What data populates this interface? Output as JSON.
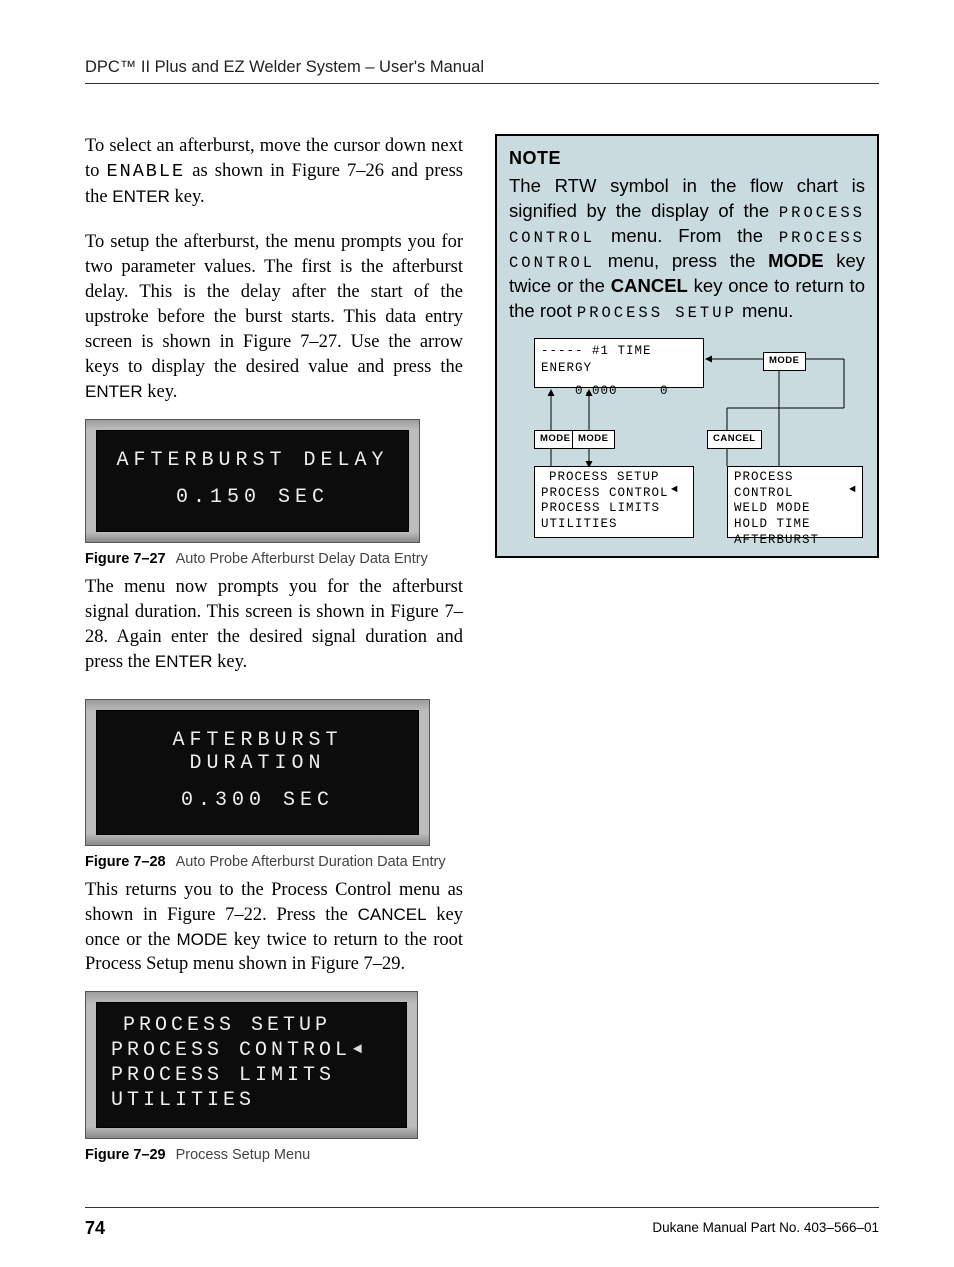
{
  "header": {
    "title": "DPC™ II Plus and EZ Welder System – User's Manual"
  },
  "body": {
    "p1_a": "To select an afterburst, move the cursor down next to ",
    "p1_b": " as shown in Figure 7–26 and press the ",
    "p1_c": " key.",
    "key_enable": "ENABLE",
    "key_enter": "ENTER",
    "p2_a": "To setup the afterburst, the menu prompts you for two parameter values. The first is the afterburst delay. This is the delay after the start of the upstroke before the burst starts. This data entry screen is shown in Figure 7–27. Use the arrow keys to display the desired value and press the ",
    "p2_b": " key.",
    "p3_a": "The menu now prompts you for the afterburst signal duration. This screen is shown in Figure 7–28. Again enter the desired signal duration and press the ",
    "p3_b": " key.",
    "p4_a": "This returns you to the Process Control menu as shown in Figure 7–22. Press the ",
    "p4_b": " key once or the ",
    "p4_c": " key twice to return to the root Process Setup menu shown in Figure 7–29.",
    "key_cancel": "CANCEL",
    "key_mode": "MODE"
  },
  "fig27": {
    "line1": "AFTERBURST DELAY",
    "line2": "0.150 SEC",
    "cap_num": "Figure 7–27",
    "cap_txt": "Auto Probe Afterburst Delay Data Entry"
  },
  "fig28": {
    "line1": "AFTERBURST DURATION",
    "line2": "0.300 SEC",
    "cap_num": "Figure 7–28",
    "cap_txt": "Auto Probe Afterburst Duration Data Entry"
  },
  "fig29": {
    "l1": "PROCESS SETUP",
    "l2": "PROCESS CONTROL",
    "l3": "PROCESS LIMITS",
    "l4": "UTILITIES",
    "cursor": "◄",
    "cap_num": "Figure 7–29",
    "cap_txt": "Process Setup Menu"
  },
  "note": {
    "heading": "NOTE",
    "t1": "The RTW symbol in the flow chart is signified by the display of the ",
    "ocr_pc": "PROCESS CONTROL",
    "t2": " menu. From the ",
    "t3": " menu, press the ",
    "k_mode": "MODE",
    "t4": " key twice or the ",
    "k_cancel": "CANCEL",
    "t5": " key once to return to the root ",
    "ocr_ps": "PROCESS SETUP",
    "t6": " menu."
  },
  "flow": {
    "top_row1": "----- #1 TIME  ENERGY",
    "top_row2a": "0.000",
    "top_row2b": "0",
    "btn_mode": "MODE",
    "btn_cancel": "CANCEL",
    "left_menu_1": "PROCESS SETUP",
    "left_menu_2": "PROCESS CONTROL",
    "left_menu_3": "PROCESS LIMITS",
    "left_menu_4": "UTILITIES",
    "right_menu_1": "PROCESS CONTROL",
    "right_menu_2": "WELD MODE",
    "right_menu_3": "HOLD TIME",
    "right_menu_4": "AFTERBURST",
    "cursor": "◄"
  },
  "footer": {
    "page": "74",
    "part": "Dukane Manual Part No. 403–566–01"
  }
}
